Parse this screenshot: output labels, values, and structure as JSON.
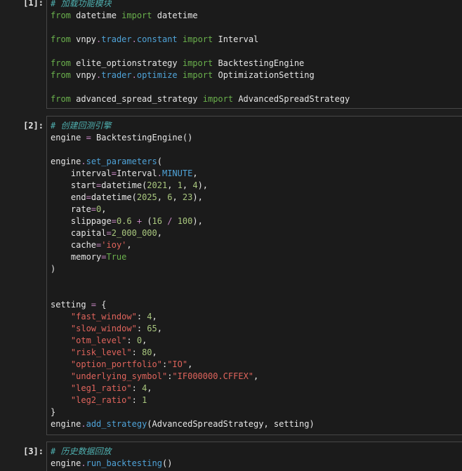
{
  "cells": [
    {
      "prompt": "[1]:",
      "lines": [
        [
          {
            "t": "# 加载功能模块",
            "c": "cm"
          }
        ],
        [
          {
            "t": "from",
            "c": "kw"
          },
          {
            "t": " datetime ",
            "c": "txt"
          },
          {
            "t": "import",
            "c": "kw"
          },
          {
            "t": " datetime",
            "c": "txt"
          }
        ],
        [],
        [
          {
            "t": "from",
            "c": "kw"
          },
          {
            "t": " vnpy",
            "c": "txt"
          },
          {
            "t": ".",
            "c": "op"
          },
          {
            "t": "trader",
            "c": "attr"
          },
          {
            "t": ".",
            "c": "op"
          },
          {
            "t": "constant",
            "c": "attr"
          },
          {
            "t": " ",
            "c": "txt"
          },
          {
            "t": "import",
            "c": "kw"
          },
          {
            "t": " Interval",
            "c": "txt"
          }
        ],
        [],
        [
          {
            "t": "from",
            "c": "kw"
          },
          {
            "t": " elite_optionstrategy ",
            "c": "txt"
          },
          {
            "t": "import",
            "c": "kw"
          },
          {
            "t": " BacktestingEngine",
            "c": "txt"
          }
        ],
        [
          {
            "t": "from",
            "c": "kw"
          },
          {
            "t": " vnpy",
            "c": "txt"
          },
          {
            "t": ".",
            "c": "op"
          },
          {
            "t": "trader",
            "c": "attr"
          },
          {
            "t": ".",
            "c": "op"
          },
          {
            "t": "optimize",
            "c": "attr"
          },
          {
            "t": " ",
            "c": "txt"
          },
          {
            "t": "import",
            "c": "kw"
          },
          {
            "t": " OptimizationSetting",
            "c": "txt"
          }
        ],
        [],
        [
          {
            "t": "from",
            "c": "kw"
          },
          {
            "t": " advanced_spread_strategy ",
            "c": "txt"
          },
          {
            "t": "import",
            "c": "kw"
          },
          {
            "t": " AdvancedSpreadStrategy",
            "c": "txt"
          }
        ]
      ]
    },
    {
      "prompt": "[2]:",
      "lines": [
        [
          {
            "t": "# 创建回测引擎",
            "c": "cm"
          }
        ],
        [
          {
            "t": "engine ",
            "c": "txt"
          },
          {
            "t": "=",
            "c": "op"
          },
          {
            "t": " BacktestingEngine()",
            "c": "txt"
          }
        ],
        [],
        [
          {
            "t": "engine",
            "c": "txt"
          },
          {
            "t": ".",
            "c": "op"
          },
          {
            "t": "set_parameters",
            "c": "fn"
          },
          {
            "t": "(",
            "c": "txt"
          }
        ],
        [
          {
            "t": "    interval",
            "c": "txt"
          },
          {
            "t": "=",
            "c": "op"
          },
          {
            "t": "Interval",
            "c": "txt"
          },
          {
            "t": ".",
            "c": "op"
          },
          {
            "t": "MINUTE",
            "c": "cst"
          },
          {
            "t": ",",
            "c": "txt"
          }
        ],
        [
          {
            "t": "    start",
            "c": "txt"
          },
          {
            "t": "=",
            "c": "op"
          },
          {
            "t": "datetime(",
            "c": "txt"
          },
          {
            "t": "2021",
            "c": "num"
          },
          {
            "t": ", ",
            "c": "txt"
          },
          {
            "t": "1",
            "c": "num"
          },
          {
            "t": ", ",
            "c": "txt"
          },
          {
            "t": "4",
            "c": "num"
          },
          {
            "t": "),",
            "c": "txt"
          }
        ],
        [
          {
            "t": "    end",
            "c": "txt"
          },
          {
            "t": "=",
            "c": "op"
          },
          {
            "t": "datetime(",
            "c": "txt"
          },
          {
            "t": "2025",
            "c": "num"
          },
          {
            "t": ", ",
            "c": "txt"
          },
          {
            "t": "6",
            "c": "num"
          },
          {
            "t": ", ",
            "c": "txt"
          },
          {
            "t": "23",
            "c": "num"
          },
          {
            "t": "),",
            "c": "txt"
          }
        ],
        [
          {
            "t": "    rate",
            "c": "txt"
          },
          {
            "t": "=",
            "c": "op"
          },
          {
            "t": "0",
            "c": "num"
          },
          {
            "t": ",",
            "c": "txt"
          }
        ],
        [
          {
            "t": "    slippage",
            "c": "txt"
          },
          {
            "t": "=",
            "c": "op"
          },
          {
            "t": "0.6",
            "c": "num"
          },
          {
            "t": " ",
            "c": "txt"
          },
          {
            "t": "+",
            "c": "op"
          },
          {
            "t": " (",
            "c": "txt"
          },
          {
            "t": "16",
            "c": "num"
          },
          {
            "t": " ",
            "c": "txt"
          },
          {
            "t": "/",
            "c": "op"
          },
          {
            "t": " ",
            "c": "txt"
          },
          {
            "t": "100",
            "c": "num"
          },
          {
            "t": "),",
            "c": "txt"
          }
        ],
        [
          {
            "t": "    capital",
            "c": "txt"
          },
          {
            "t": "=",
            "c": "op"
          },
          {
            "t": "2_000_000",
            "c": "num"
          },
          {
            "t": ",",
            "c": "txt"
          }
        ],
        [
          {
            "t": "    cache",
            "c": "txt"
          },
          {
            "t": "=",
            "c": "op"
          },
          {
            "t": "'ioy'",
            "c": "str"
          },
          {
            "t": ",",
            "c": "txt"
          }
        ],
        [
          {
            "t": "    memory",
            "c": "txt"
          },
          {
            "t": "=",
            "c": "op"
          },
          {
            "t": "True",
            "c": "bool"
          }
        ],
        [
          {
            "t": ")",
            "c": "txt"
          }
        ],
        [],
        [],
        [
          {
            "t": "setting ",
            "c": "txt"
          },
          {
            "t": "=",
            "c": "op"
          },
          {
            "t": " {",
            "c": "txt"
          }
        ],
        [
          {
            "t": "    ",
            "c": "txt"
          },
          {
            "t": "\"fast_window\"",
            "c": "str"
          },
          {
            "t": ": ",
            "c": "txt"
          },
          {
            "t": "4",
            "c": "num"
          },
          {
            "t": ",",
            "c": "txt"
          }
        ],
        [
          {
            "t": "    ",
            "c": "txt"
          },
          {
            "t": "\"slow_window\"",
            "c": "str"
          },
          {
            "t": ": ",
            "c": "txt"
          },
          {
            "t": "65",
            "c": "num"
          },
          {
            "t": ",",
            "c": "txt"
          }
        ],
        [
          {
            "t": "    ",
            "c": "txt"
          },
          {
            "t": "\"otm_level\"",
            "c": "str"
          },
          {
            "t": ": ",
            "c": "txt"
          },
          {
            "t": "0",
            "c": "num"
          },
          {
            "t": ",",
            "c": "txt"
          }
        ],
        [
          {
            "t": "    ",
            "c": "txt"
          },
          {
            "t": "\"risk_level\"",
            "c": "str"
          },
          {
            "t": ": ",
            "c": "txt"
          },
          {
            "t": "80",
            "c": "num"
          },
          {
            "t": ",",
            "c": "txt"
          }
        ],
        [
          {
            "t": "    ",
            "c": "txt"
          },
          {
            "t": "\"option_portfolio\"",
            "c": "str"
          },
          {
            "t": ":",
            "c": "txt"
          },
          {
            "t": "\"IO\"",
            "c": "str"
          },
          {
            "t": ",",
            "c": "txt"
          }
        ],
        [
          {
            "t": "    ",
            "c": "txt"
          },
          {
            "t": "\"underlying_symbol\"",
            "c": "str"
          },
          {
            "t": ":",
            "c": "txt"
          },
          {
            "t": "\"IF000000.CFFEX\"",
            "c": "str"
          },
          {
            "t": ",",
            "c": "txt"
          }
        ],
        [
          {
            "t": "    ",
            "c": "txt"
          },
          {
            "t": "\"leg1_ratio\"",
            "c": "str"
          },
          {
            "t": ": ",
            "c": "txt"
          },
          {
            "t": "4",
            "c": "num"
          },
          {
            "t": ",",
            "c": "txt"
          }
        ],
        [
          {
            "t": "    ",
            "c": "txt"
          },
          {
            "t": "\"leg2_ratio\"",
            "c": "str"
          },
          {
            "t": ": ",
            "c": "txt"
          },
          {
            "t": "1",
            "c": "num"
          }
        ],
        [
          {
            "t": "}",
            "c": "txt"
          }
        ],
        [
          {
            "t": "engine",
            "c": "txt"
          },
          {
            "t": ".",
            "c": "op"
          },
          {
            "t": "add_strategy",
            "c": "fn"
          },
          {
            "t": "(AdvancedSpreadStrategy, setting)",
            "c": "txt"
          }
        ]
      ]
    },
    {
      "prompt": "[3]:",
      "lines": [
        [
          {
            "t": "# 历史数据回放",
            "c": "cm"
          }
        ],
        [
          {
            "t": "engine",
            "c": "txt"
          },
          {
            "t": ".",
            "c": "op"
          },
          {
            "t": "run_backtesting",
            "c": "fn"
          },
          {
            "t": "()",
            "c": "txt"
          }
        ]
      ]
    }
  ]
}
